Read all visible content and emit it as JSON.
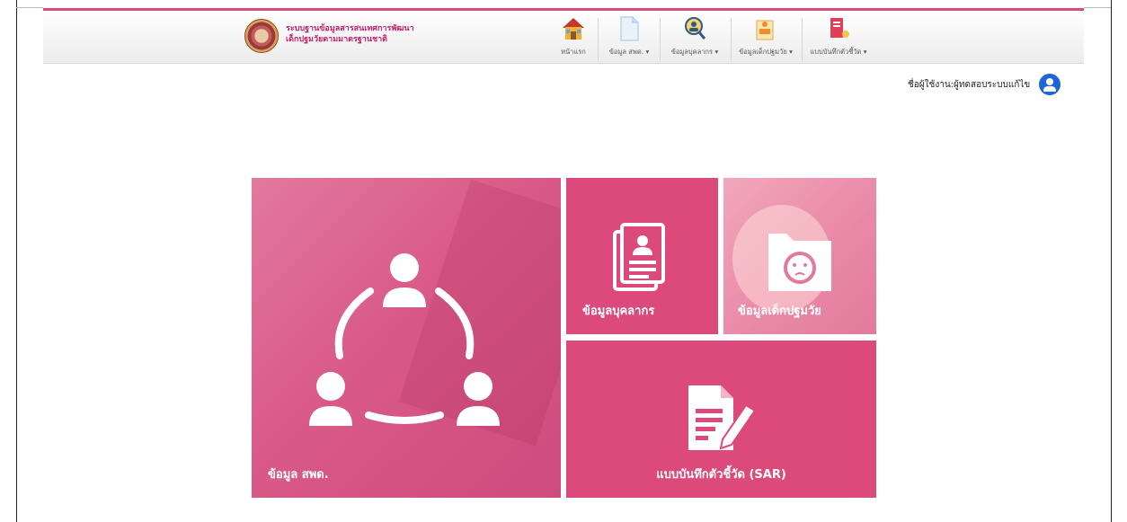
{
  "brand": {
    "line1": "ระบบฐานข้อมูลสารสนเทศการพัฒนา",
    "line2": "เด็กปฐมวัยตามมาตรฐานชาติ"
  },
  "menu": [
    {
      "label": "หน้าแรก",
      "icon": "home-icon"
    },
    {
      "label": "ข้อมูล สพด. ▾",
      "icon": "document-icon"
    },
    {
      "label": "ข้อมูลบุคลากร ▾",
      "icon": "personnel-search-icon"
    },
    {
      "label": "ข้อมูลเด็กปฐมวัย ▾",
      "icon": "child-doc-icon"
    },
    {
      "label": "แบบบันทึกตัวชี้วัด ▾",
      "icon": "report-book-icon"
    }
  ],
  "user": {
    "name": "ชื่อผู้ใช้งาน:ผู้ทดสอบระบบแก้ไข",
    "icon": "user-circle-icon"
  },
  "tiles": {
    "centers": "ข้อมูล สพด.",
    "personnel": "ข้อมูลบุคลากร",
    "children": "ข้อมูลเด็กปฐมวัย",
    "sar": "แบบบันทึกตัวชี้วัด (SAR)"
  },
  "colors": {
    "accent": "#d84a7c",
    "tile": "#db4a7a",
    "user": "#1e66d6"
  }
}
